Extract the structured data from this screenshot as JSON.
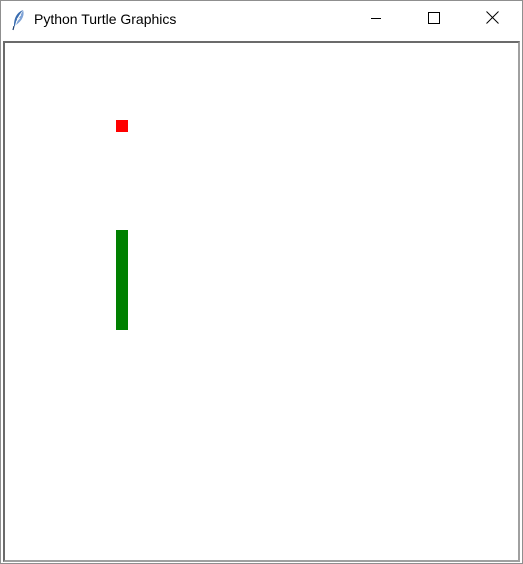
{
  "window": {
    "title": "Python Turtle Graphics",
    "icon": "feather-icon",
    "controls": {
      "minimize": "minimize-icon",
      "maximize": "maximize-icon",
      "close": "close-icon"
    }
  },
  "canvas": {
    "background": "#ffffff",
    "food": {
      "color": "#ff0000",
      "shape": "square"
    },
    "snake": {
      "color": "#008000",
      "segments": 5
    }
  }
}
